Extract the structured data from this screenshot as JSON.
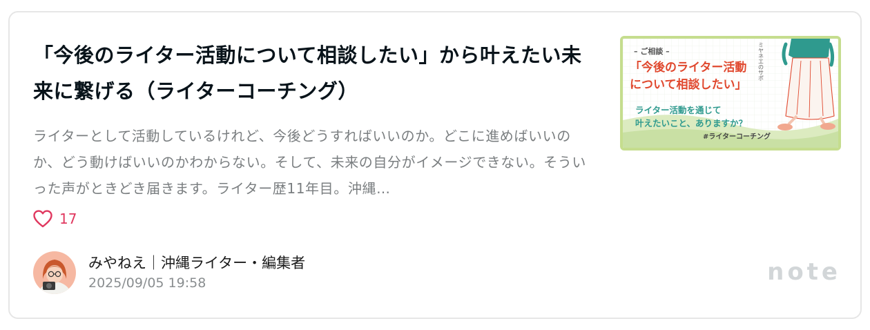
{
  "article": {
    "title": "「今後のライター活動について相談したい」から叶えたい未来に繋げる（ライターコーチング）",
    "excerpt": "ライターとして活動しているけれど、今後どうすればいいのか。どこに進めばいいのか、どう動けばいいのかわからない。そして、未来の自分がイメージできない。そういった声がときどき届きます。ライター歴11年目。沖縄…",
    "like_count": "17",
    "author_name": "みやねえ｜沖縄ライター・編集者",
    "date": "2025/09/05 19:58"
  },
  "thumbnail": {
    "small_label": "– ご相談 –",
    "headline_line1": "「今後のライター活動",
    "headline_line2": "について相談したい」",
    "sub_line1": "ライター活動を通じて",
    "sub_line2": "叶えたいこと、ありますか？",
    "hashtag": "#ライターコーチング",
    "vertical_text": "ミヤネエのサポ"
  },
  "brand": {
    "logo_text": "note"
  },
  "colors": {
    "like_accent": "#e0385f",
    "thumb_border": "#c5dd8e",
    "thumb_headline": "#e0482e",
    "thumb_sub": "#2f9a8e"
  },
  "icons": {
    "like": "heart-outline-icon"
  }
}
